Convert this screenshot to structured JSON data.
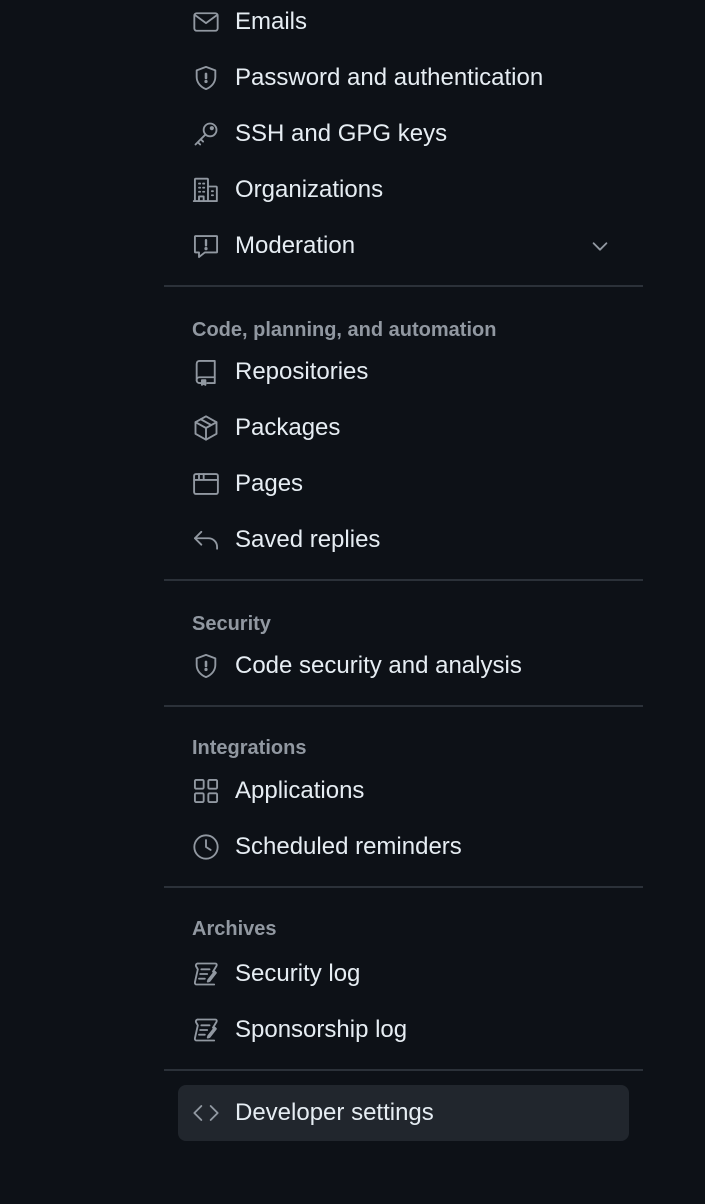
{
  "sections": [
    {
      "heading": "",
      "items": [
        {
          "label": "Emails",
          "icon": "mail-icon"
        },
        {
          "label": "Password and authentication",
          "icon": "shield-icon"
        },
        {
          "label": "SSH and GPG keys",
          "icon": "key-icon"
        },
        {
          "label": "Organizations",
          "icon": "organization-icon"
        },
        {
          "label": "Moderation",
          "icon": "report-icon",
          "expandable": true
        }
      ]
    },
    {
      "heading": "Code, planning, and automation",
      "items": [
        {
          "label": "Repositories",
          "icon": "repo-icon"
        },
        {
          "label": "Packages",
          "icon": "package-icon"
        },
        {
          "label": "Pages",
          "icon": "browser-icon"
        },
        {
          "label": "Saved replies",
          "icon": "reply-icon"
        }
      ]
    },
    {
      "heading": "Security",
      "items": [
        {
          "label": "Code security and analysis",
          "icon": "shield-icon"
        }
      ]
    },
    {
      "heading": "Integrations",
      "items": [
        {
          "label": "Applications",
          "icon": "apps-icon"
        },
        {
          "label": "Scheduled reminders",
          "icon": "clock-icon"
        }
      ]
    },
    {
      "heading": "Archives",
      "items": [
        {
          "label": "Security log",
          "icon": "log-icon"
        },
        {
          "label": "Sponsorship log",
          "icon": "log-icon"
        }
      ]
    }
  ],
  "footer_item": {
    "label": "Developer settings",
    "icon": "code-icon",
    "active": true
  },
  "colors": {
    "background": "#0d1117",
    "text": "#e6edf3",
    "muted": "#9198a1",
    "divider": "#2b3139",
    "active_bg": "#21262d"
  }
}
